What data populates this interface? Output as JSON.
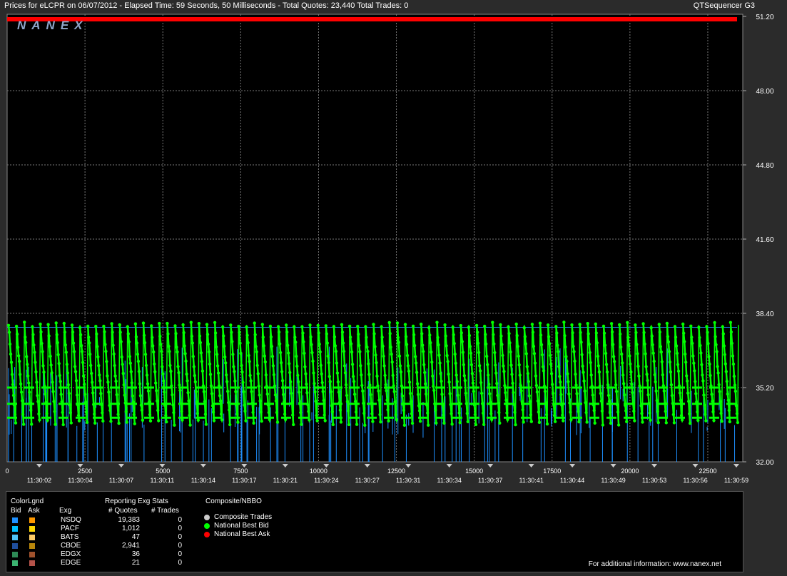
{
  "header": {
    "title_left": "Prices for  eLCPR  on  06/07/2012  -  Elapsed Time: 59 Seconds, 50 Milliseconds  -  Total Quotes: 23,440  Total Trades: 0",
    "title_right": "QTSequencer G3",
    "logo": "NANEX"
  },
  "chart_data": {
    "type": "line",
    "y_ticks": [
      "51.20",
      "48.00",
      "44.80",
      "41.60",
      "38.40",
      "35.20",
      "32.00"
    ],
    "ylim": [
      32.0,
      51.2
    ],
    "x_index_ticks": [
      "0",
      "2500",
      "5000",
      "7500",
      "10000",
      "12500",
      "15000",
      "17500",
      "20000",
      "22500"
    ],
    "x_index_range": [
      0,
      23440
    ],
    "time_ticks": [
      "11:30:02",
      "11:30:04",
      "11:30:07",
      "11:30:11",
      "11:30:14",
      "11:30:17",
      "11:30:21",
      "11:30:24",
      "11:30:27",
      "11:30:31",
      "11:30:34",
      "11:30:37",
      "11:30:41",
      "11:30:44",
      "11:30:49",
      "11:30:53",
      "11:30:56",
      "11:30:59"
    ],
    "grid": true,
    "series": [
      {
        "name": "National Best Ask",
        "color": "#ff0000",
        "constant_value": 51.2
      },
      {
        "name": "National Best Bid",
        "color": "#00ff00",
        "range": [
          33.7,
          37.9
        ],
        "pattern": "repeating sawtooth ramps from ~37.9 down to ~33.7"
      },
      {
        "name": "NSDQ",
        "color": "#1e90ff",
        "range": [
          32.0,
          37.8
        ]
      }
    ]
  },
  "legend": {
    "color_legend_label": "ColorLgnd",
    "bid_label": "Bid",
    "ask_label": "Ask",
    "exg_label": "Exg",
    "stats_title": "Reporting Exg Stats",
    "quotes_label": "# Quotes",
    "trades_label": "# Trades",
    "exchanges": [
      {
        "name": "NSDQ",
        "quotes": "19,383",
        "trades": "0",
        "bid_color": "#1e90ff",
        "ask_color": "#ff9900"
      },
      {
        "name": "PACF",
        "quotes": "1,012",
        "trades": "0",
        "bid_color": "#00bfff",
        "ask_color": "#ffd700"
      },
      {
        "name": "BATS",
        "quotes": "47",
        "trades": "0",
        "bid_color": "#4fc3f7",
        "ask_color": "#ffcc66"
      },
      {
        "name": "CBOE",
        "quotes": "2,941",
        "trades": "0",
        "bid_color": "#1f4e9c",
        "ask_color": "#b8860b"
      },
      {
        "name": "EDGX",
        "quotes": "36",
        "trades": "0",
        "bid_color": "#2e8b57",
        "ask_color": "#a0522d"
      },
      {
        "name": "EDGE",
        "quotes": "21",
        "trades": "0",
        "bid_color": "#3cb371",
        "ask_color": "#b5534a"
      }
    ],
    "composite_title": "Composite/NBBO",
    "composite_items": [
      {
        "label": "Composite Trades",
        "color": "#cccccc"
      },
      {
        "label": "National Best Bid",
        "color": "#00ff00"
      },
      {
        "label": "National Best Ask",
        "color": "#ff0000"
      }
    ],
    "footer": "For additional information: www.nanex.net"
  }
}
